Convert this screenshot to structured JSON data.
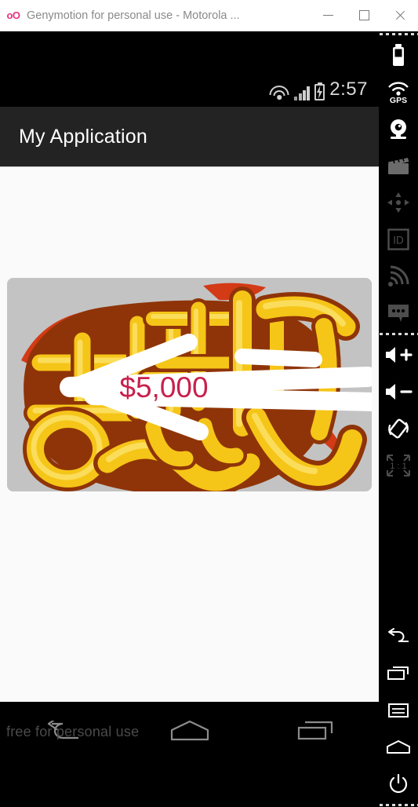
{
  "window": {
    "logo_text": "oO",
    "title": "Genymotion for personal use - Motorola ...",
    "minimize_label": "Minimize",
    "maximize_label": "Maximize",
    "close_label": "Close"
  },
  "device": {
    "statusbar": {
      "time": "2:57",
      "icons": [
        "wifi-icon",
        "cellular-signal-icon",
        "battery-charging-icon"
      ]
    },
    "appbar": {
      "title": "My Application"
    },
    "content": {
      "image_card": {
        "name": "korean-text-artwork",
        "background_color": "#c3c3c3",
        "annotation_text": "$5,000",
        "annotation_color": "#c8204c",
        "arrow_color": "#ffffff",
        "art_colors": {
          "gold": "#f5c518",
          "gold_light": "#fbdd5c",
          "brown": "#8f3408",
          "red": "#d33a16"
        }
      }
    },
    "navbar": {
      "watermark": "free for personal use",
      "buttons": [
        {
          "name": "back-button",
          "icon": "back-arrow-icon"
        },
        {
          "name": "home-button",
          "icon": "home-pentagon-icon"
        },
        {
          "name": "recents-button",
          "icon": "recents-rectangles-icon"
        }
      ]
    }
  },
  "toolbar": {
    "items": [
      {
        "name": "battery-widget-button",
        "icon": "battery-icon",
        "label": "Battery",
        "enabled": true
      },
      {
        "name": "gps-widget-button",
        "icon": "gps-icon",
        "label": "GPS",
        "enabled": true
      },
      {
        "name": "camera-widget-button",
        "icon": "webcam-icon",
        "label": "Camera",
        "enabled": true
      },
      {
        "name": "screencast-button",
        "icon": "clapperboard-icon",
        "label": "Screencast",
        "enabled": false
      },
      {
        "name": "dpad-button",
        "icon": "dpad-icon",
        "label": "D-Pad",
        "enabled": false
      },
      {
        "name": "identifiers-button",
        "icon": "id-icon",
        "label": "ID",
        "enabled": false
      },
      {
        "name": "network-button",
        "icon": "network-signal-icon",
        "label": "Network",
        "enabled": false
      },
      {
        "name": "phone-sms-button",
        "icon": "chat-bubble-icon",
        "label": "Phone / SMS",
        "enabled": false
      },
      {
        "name": "volume-up-button",
        "icon": "volume-up-icon",
        "label": "Volume up",
        "enabled": true
      },
      {
        "name": "volume-down-button",
        "icon": "volume-down-icon",
        "label": "Volume down",
        "enabled": true
      },
      {
        "name": "rotate-button",
        "icon": "rotate-screen-icon",
        "label": "Rotate",
        "enabled": true
      },
      {
        "name": "scale-one-to-one-button",
        "icon": "scale-1-1-icon",
        "label": "1:1",
        "enabled": false
      },
      {
        "name": "nav-back-button",
        "icon": "back-arrow-icon",
        "label": "Back",
        "enabled": true
      },
      {
        "name": "nav-recents-button",
        "icon": "recents-rectangles-icon",
        "label": "Recent apps",
        "enabled": true
      },
      {
        "name": "nav-menu-button",
        "icon": "menu-icon",
        "label": "Menu",
        "enabled": true
      },
      {
        "name": "nav-home-button",
        "icon": "home-pentagon-icon",
        "label": "Home",
        "enabled": true
      },
      {
        "name": "power-button",
        "icon": "power-icon",
        "label": "Power",
        "enabled": true
      }
    ],
    "scale_label": "1 : 1",
    "gps_label": "GPS",
    "id_label": "ID"
  }
}
